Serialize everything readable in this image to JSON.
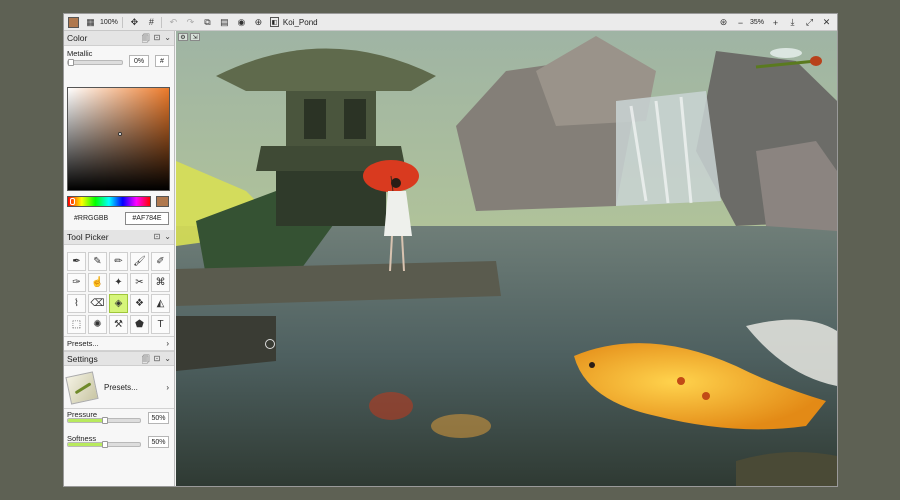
{
  "toolbar": {
    "zoom_pct": "100%",
    "file_name": "Koi_Pond",
    "view_zoom": "35%"
  },
  "color_panel": {
    "title": "Color",
    "metallic_label": "Metallic",
    "metallic_value": "0%",
    "metallic_level": 0.0,
    "hash_button": "#",
    "hex_label": "#RRGGBB",
    "hex_value": "#AF784E",
    "current_color": "#af784e"
  },
  "tool_picker": {
    "title": "Tool Picker",
    "tools": [
      "pen-icon",
      "marker-icon",
      "pencil-icon",
      "brush-icon",
      "airbrush-icon",
      "ink-pen-icon",
      "smudge-icon",
      "blender-icon",
      "knife-icon",
      "bristle-brush-icon",
      "dropper-icon",
      "eraser-icon",
      "fill-icon",
      "blur-icon",
      "gradient-icon",
      "selection-icon",
      "spray-icon",
      "paintbrush-icon",
      "shape-icon",
      "text-icon"
    ],
    "active_index": 12,
    "text_tool_glyph": "T",
    "presets_label": "Presets..."
  },
  "settings_panel": {
    "title": "Settings",
    "preset_label": "Presets...",
    "pressure_label": "Pressure",
    "pressure_value": "50%",
    "pressure_level": 0.5,
    "softness_label": "Softness",
    "softness_value": "50%",
    "softness_level": 0.5
  },
  "colors": {
    "accent": "#b8ea5d",
    "panel_bg": "#f7f7f7",
    "header_bg": "#e4e4e4"
  }
}
